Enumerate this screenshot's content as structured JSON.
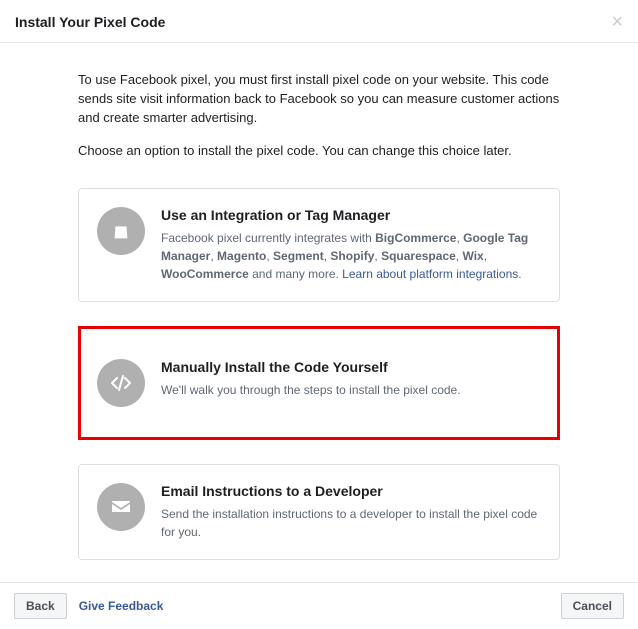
{
  "header": {
    "title": "Install Your Pixel Code"
  },
  "intro": "To use Facebook pixel, you must first install pixel code on your website. This code sends site visit information back to Facebook so you can measure customer actions and create smarter advertising.",
  "choose": "Choose an option to install the pixel code. You can change this choice later.",
  "options": {
    "integration": {
      "title": "Use an Integration or Tag Manager",
      "desc_prefix": "Facebook pixel currently integrates with ",
      "platforms": [
        "BigCommerce",
        "Google Tag Manager",
        "Magento",
        "Segment",
        "Shopify",
        "Squarespace",
        "Wix",
        "WooCommerce"
      ],
      "desc_suffix": " and many more. ",
      "link": "Learn about platform integrations"
    },
    "manual": {
      "title": "Manually Install the Code Yourself",
      "desc": "We'll walk you through the steps to install the pixel code."
    },
    "email": {
      "title": "Email Instructions to a Developer",
      "desc": "Send the installation instructions to a developer to install the pixel code for you."
    }
  },
  "footer": {
    "back": "Back",
    "feedback": "Give Feedback",
    "cancel": "Cancel"
  }
}
